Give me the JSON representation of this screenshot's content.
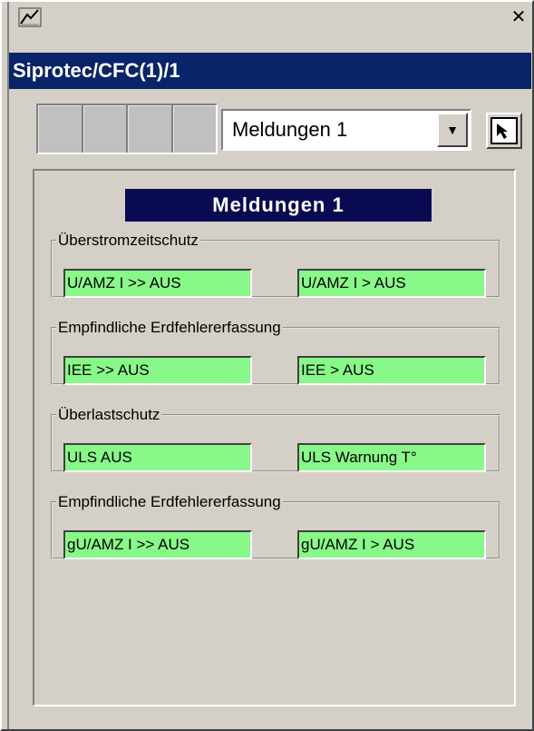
{
  "window": {
    "title": "Siprotec/CFC(1)/1",
    "close_glyph": "✕"
  },
  "toolbar": {
    "combo_value": "Meldungen 1",
    "combo_arrow": "▼"
  },
  "view": {
    "title": "Meldungen 1",
    "groups": [
      {
        "label": "Überstromzeitschutz",
        "left": "U/AMZ I >> AUS",
        "right": "U/AMZ I > AUS"
      },
      {
        "label": "Empfindliche Erdfehlererfassung",
        "left": "IEE >> AUS",
        "right": "IEE > AUS"
      },
      {
        "label": "Überlastschutz",
        "left": "ULS AUS",
        "right": "ULS Warnung T°"
      },
      {
        "label": "Empfindliche Erdfehlererfassung",
        "left": "gU/AMZ I >> AUS",
        "right": "gU/AMZ I > AUS"
      }
    ]
  },
  "colors": {
    "title_bar": "#0a246a",
    "view_title": "#0a0a52",
    "indicator_on": "#88f888",
    "face": "#d4d0c8"
  }
}
